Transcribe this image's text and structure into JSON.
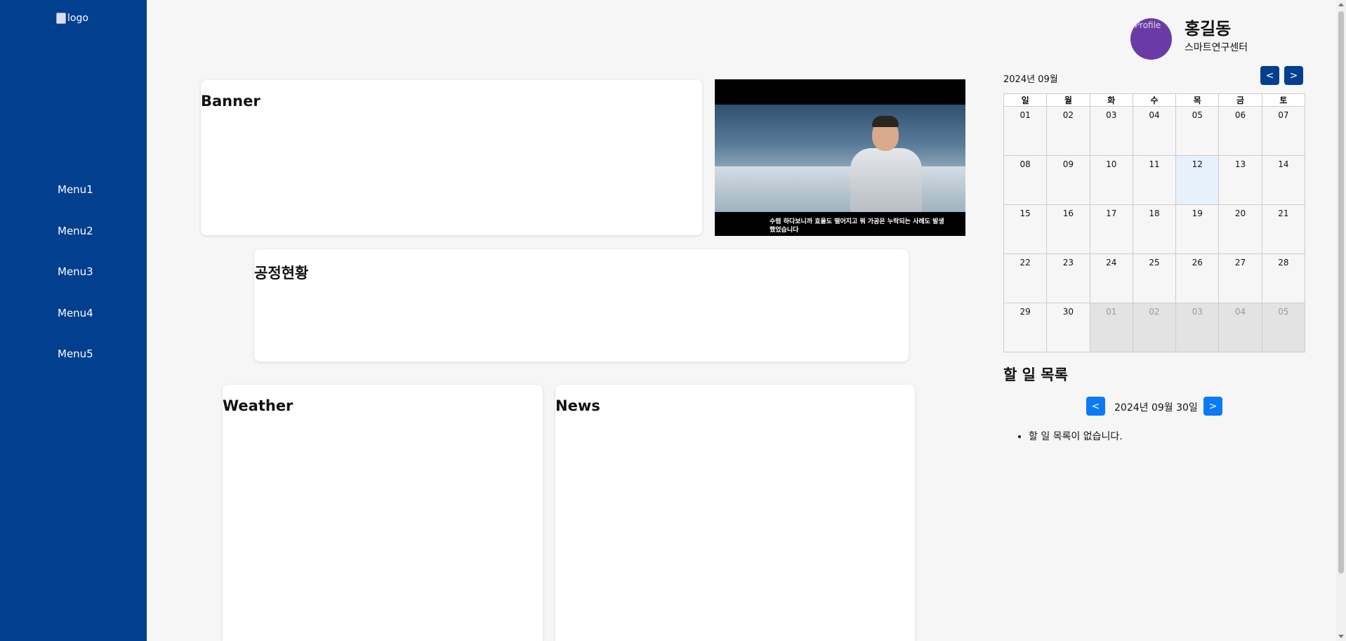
{
  "sidebar": {
    "logo_alt": "logo",
    "menu": [
      "Menu1",
      "Menu2",
      "Menu3",
      "Menu4",
      "Menu5"
    ]
  },
  "cards": {
    "banner": "Banner",
    "process": "공정현황",
    "weather": "Weather",
    "news": "News"
  },
  "video": {
    "caption_line1": "수렴 하다보니까 효율도 떨어지고 뭐 가공은 누락되는 사례도 발생",
    "caption_line2": "했었습니다"
  },
  "profile": {
    "avatar_alt": "Profile",
    "name": "홍길동",
    "org": "스마트연구센터"
  },
  "calendar": {
    "month_label": "2024년 09월",
    "prev_label": "<",
    "next_label": ">",
    "weekdays": [
      "일",
      "월",
      "화",
      "수",
      "목",
      "금",
      "토"
    ],
    "weeks": [
      [
        "01",
        "02",
        "03",
        "04",
        "05",
        "06",
        "07"
      ],
      [
        "08",
        "09",
        "10",
        "11",
        "12",
        "13",
        "14"
      ],
      [
        "15",
        "16",
        "17",
        "18",
        "19",
        "20",
        "21"
      ],
      [
        "22",
        "23",
        "24",
        "25",
        "26",
        "27",
        "28"
      ],
      [
        "29",
        "30",
        "01",
        "02",
        "03",
        "04",
        "05"
      ]
    ],
    "today": "12"
  },
  "todo": {
    "title": "할 일 목록",
    "prev_label": "<",
    "next_label": ">",
    "date_label": "2024년 09월 30일",
    "empty_text": "할 일 목록이 없습니다."
  },
  "colors": {
    "sidebar": "#023f8f",
    "calendar_nav": "#023f8f",
    "todo_nav": "#0a7bf5",
    "avatar": "#6a3ba6",
    "today_cell": "#e7f1fb",
    "other_month_cell": "#e3e3e3"
  }
}
